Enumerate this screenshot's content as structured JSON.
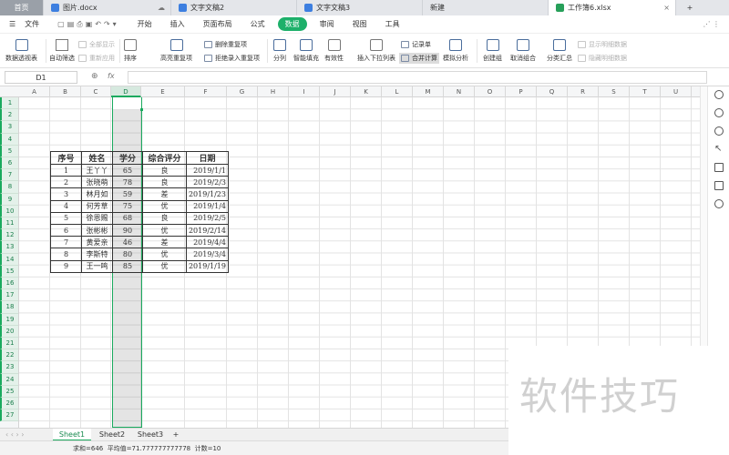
{
  "doc_tabs": [
    {
      "label": "首页",
      "kind": "home"
    },
    {
      "label": "图片.docx",
      "kind": "word"
    },
    {
      "label": "文字文稿2",
      "kind": "word"
    },
    {
      "label": "文字文稿3",
      "kind": "word"
    },
    {
      "label": "新建",
      "kind": "new"
    },
    {
      "label": "工作簿6.xlsx",
      "kind": "sheet"
    }
  ],
  "plus_label": "+",
  "menu": {
    "file": "文件",
    "items": [
      "开始",
      "插入",
      "页面布局",
      "公式",
      "数据",
      "审阅",
      "视图",
      "工具"
    ],
    "active": "数据"
  },
  "ribbon": {
    "pivot": "数据透视表",
    "autofilter": "自动筛选",
    "show_all": "全部显示",
    "reapply": "重新应用",
    "sort": "排序",
    "highlight_dup": "高亮重复项",
    "delete_dup": "删除重复项",
    "reject_dup": "拒绝录入重复项",
    "split_col": "分列",
    "smart_fill": "智能填充",
    "validity": "有效性",
    "dropdown": "插入下拉列表",
    "record": "记录单",
    "merge_calc": "合并计算",
    "simulate": "模拟分析",
    "create_group": "创建组",
    "ungroup": "取消组合",
    "subtotal": "分类汇总",
    "show_detail": "显示明细数据",
    "hide_detail": "隐藏明细数据"
  },
  "formula": {
    "name_box": "D1",
    "fx": "fx",
    "value": ""
  },
  "columns": [
    "A",
    "B",
    "C",
    "D",
    "E",
    "F",
    "G",
    "H",
    "I",
    "J",
    "K",
    "L",
    "M",
    "N",
    "O",
    "P",
    "Q",
    "R",
    "S",
    "T",
    "U"
  ],
  "rows": [
    "1",
    "2",
    "3",
    "4",
    "5",
    "6",
    "7",
    "8",
    "9",
    "10",
    "11",
    "12",
    "13",
    "14",
    "15",
    "16",
    "17",
    "18",
    "19",
    "20",
    "21",
    "22",
    "23",
    "24",
    "25",
    "26",
    "27"
  ],
  "selected_column": "D",
  "table": {
    "headers": [
      "序号",
      "姓名",
      "学分",
      "综合评分",
      "日期"
    ],
    "rows": [
      [
        "1",
        "王丫丫",
        "65",
        "良",
        "2019/1/1"
      ],
      [
        "2",
        "张晓萌",
        "78",
        "良",
        "2019/2/3"
      ],
      [
        "3",
        "林月如",
        "59",
        "差",
        "2019/1/23"
      ],
      [
        "4",
        "何芳草",
        "75",
        "优",
        "2019/1/4"
      ],
      [
        "5",
        "徐恩赐",
        "68",
        "良",
        "2019/2/5"
      ],
      [
        "6",
        "张彬彬",
        "90",
        "优",
        "2019/2/14"
      ],
      [
        "7",
        "黄爱亲",
        "46",
        "差",
        "2019/4/4"
      ],
      [
        "8",
        "李斯特",
        "80",
        "优",
        "2019/3/4"
      ],
      [
        "9",
        "王一鸣",
        "85",
        "优",
        "2019/1/19"
      ]
    ]
  },
  "sheets": [
    "Sheet1",
    "Sheet2",
    "Sheet3"
  ],
  "add_sheet": "+",
  "status": {
    "sum": "求和=646",
    "avg": "平均值=71.777777777778",
    "count": "计数=10"
  },
  "watermark": "软件技巧",
  "colors": {
    "accent": "#1aaa5e",
    "word_icon": "#3d7fe0",
    "sheet_icon": "#27a05a"
  }
}
